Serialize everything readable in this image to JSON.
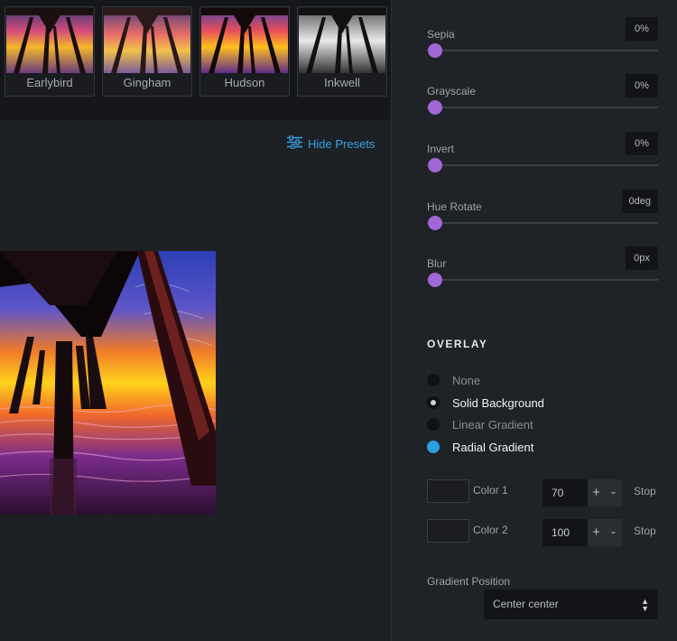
{
  "presets": [
    {
      "label": "Earlybird",
      "style": "warm"
    },
    {
      "label": "Gingham",
      "style": "faded"
    },
    {
      "label": "Hudson",
      "style": "vivid"
    },
    {
      "label": "Inkwell",
      "style": "mono"
    }
  ],
  "hide_presets_label": "Hide Presets",
  "sliders": [
    {
      "label": "Sepia",
      "value": "0%"
    },
    {
      "label": "Grayscale",
      "value": "0%"
    },
    {
      "label": "Invert",
      "value": "0%"
    },
    {
      "label": "Hue Rotate",
      "value": "0deg"
    },
    {
      "label": "Blur",
      "value": "0px"
    }
  ],
  "overlay": {
    "title": "OVERLAY",
    "options": [
      {
        "label": "None"
      },
      {
        "label": "Solid Background"
      },
      {
        "label": "Linear Gradient"
      },
      {
        "label": "Radial Gradient"
      }
    ],
    "colors": [
      {
        "label": "Color 1",
        "value": "70",
        "stop_label": "Stop"
      },
      {
        "label": "Color 2",
        "value": "100",
        "stop_label": "Stop"
      }
    ],
    "plus": "+",
    "minus": "-",
    "gradient_position_label": "Gradient Position",
    "gradient_position_value": "Center center"
  },
  "colors": {
    "accent": "#a067d6",
    "link": "#36a3e6",
    "radio_active": "#2b9fe0"
  }
}
